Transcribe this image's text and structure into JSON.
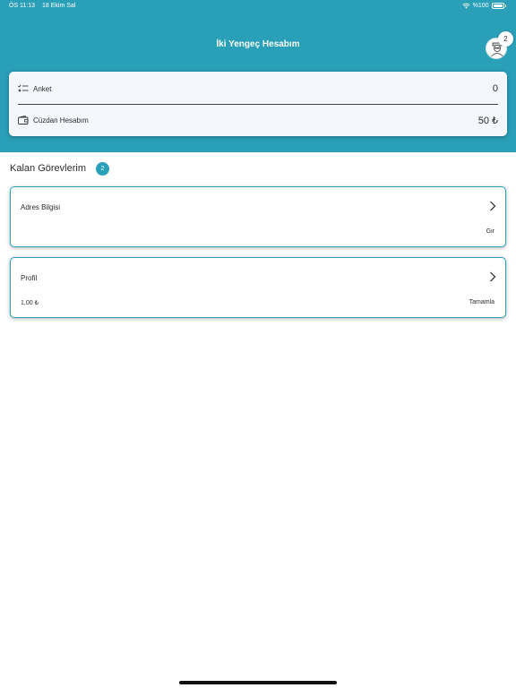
{
  "status": {
    "time": "ÖS 11:13",
    "date": "18 Ekim Sal",
    "battery": "%100"
  },
  "header": {
    "title": "İki Yengeç Hesabım",
    "notification_count": "2"
  },
  "summary": {
    "survey_label": "Anket",
    "survey_value": "0",
    "wallet_label": "Cüzdan Hesabım",
    "wallet_value": "50 ₺"
  },
  "tasks_section": {
    "title": "Kalan Görevlerim",
    "count": "2"
  },
  "tasks": [
    {
      "title": "Adres Bilgisi",
      "amount": "",
      "action": "Gir"
    },
    {
      "title": "Profil",
      "amount": "1,00 ₺",
      "action": "Tamamla"
    }
  ],
  "colors": {
    "accent": "#2a9fb8",
    "card_bg": "#f4f8fc"
  },
  "icons": [
    "wifi-icon",
    "battery-icon",
    "avatar-icon",
    "checklist-icon",
    "wallet-icon",
    "chevron-right-icon"
  ]
}
